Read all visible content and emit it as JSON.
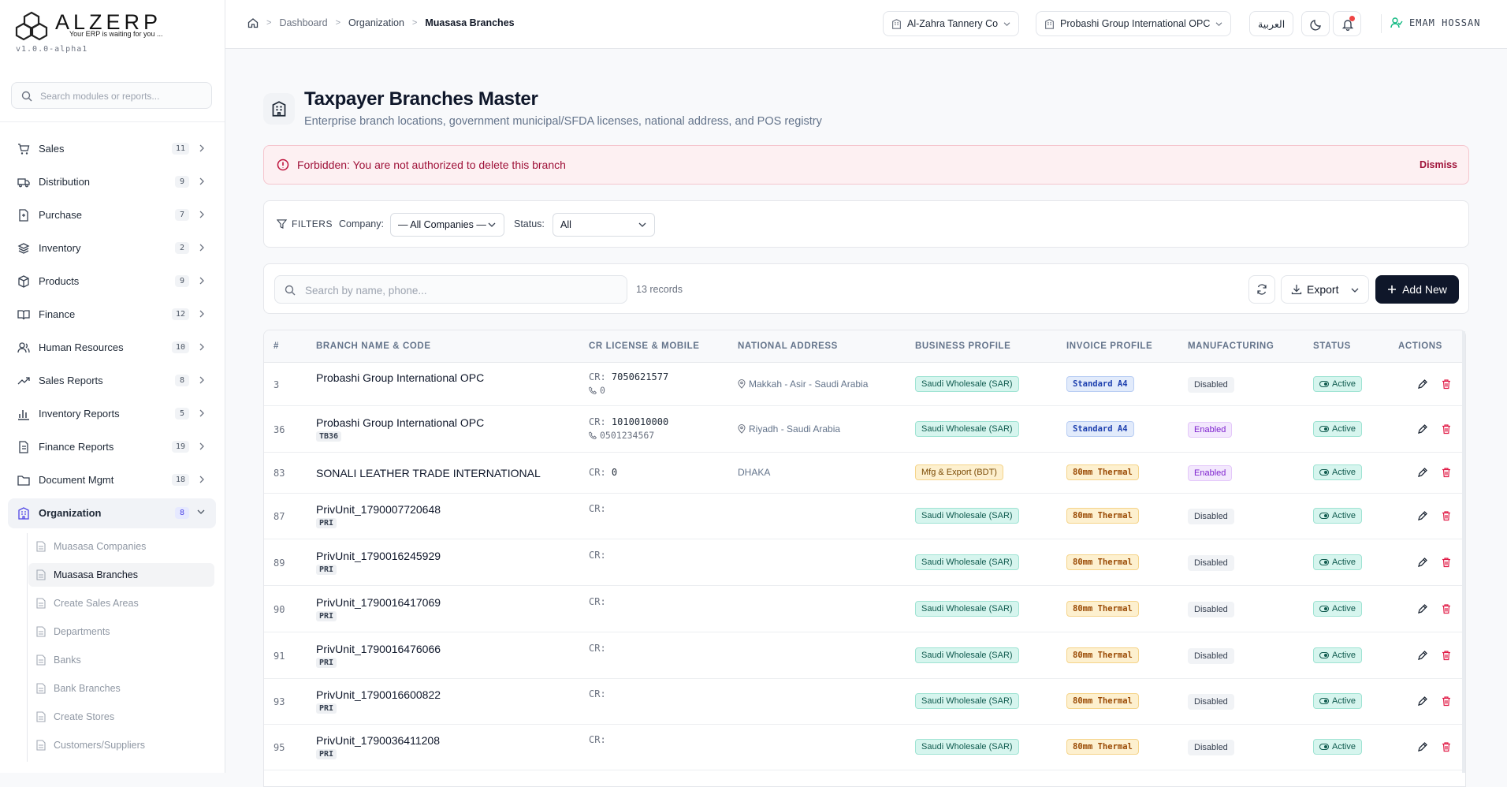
{
  "brand": {
    "name": "ALZERP",
    "tagline": "Your ERP is waiting for you ...",
    "version": "v1.0.0-alpha1"
  },
  "sidebar": {
    "search_placeholder": "Search modules or reports...",
    "items": [
      {
        "label": "Sales",
        "count": "11",
        "icon": "cart-icon"
      },
      {
        "label": "Distribution",
        "count": "9",
        "icon": "truck-icon"
      },
      {
        "label": "Purchase",
        "count": "7",
        "icon": "receipt-icon"
      },
      {
        "label": "Inventory",
        "count": "2",
        "icon": "layers-icon"
      },
      {
        "label": "Products",
        "count": "9",
        "icon": "box-icon"
      },
      {
        "label": "Finance",
        "count": "12",
        "icon": "book-icon"
      },
      {
        "label": "Human Resources",
        "count": "10",
        "icon": "users-icon"
      },
      {
        "label": "Sales Reports",
        "count": "8",
        "icon": "trend-icon"
      },
      {
        "label": "Inventory Reports",
        "count": "5",
        "icon": "bar-chart-icon"
      },
      {
        "label": "Finance Reports",
        "count": "19",
        "icon": "file-icon"
      },
      {
        "label": "Document Mgmt",
        "count": "18",
        "icon": "folder-icon"
      },
      {
        "label": "Organization",
        "count": "8",
        "icon": "building-icon"
      }
    ],
    "subitems": [
      "Muasasa Companies",
      "Muasasa Branches",
      "Create Sales Areas",
      "Departments",
      "Banks",
      "Bank Branches",
      "Create Stores",
      "Customers/Suppliers"
    ]
  },
  "header": {
    "breadcrumb": {
      "root": "Dashboard",
      "mid": "Organization",
      "current": "Muasasa Branches"
    },
    "company_selector": "Al-Zahra Tannery Co",
    "branch_selector": "Probashi Group International OPC",
    "language": "العربية",
    "user": "EMAM HOSSAN"
  },
  "page": {
    "title": "Taxpayer Branches Master",
    "subtitle": "Enterprise branch locations, government municipal/SFDA licenses, national address, and POS registry"
  },
  "alert": {
    "message": "Forbidden: You are not authorized to delete this branch",
    "dismiss": "Dismiss"
  },
  "filters": {
    "title": "FILTERS",
    "company_label": "Company:",
    "company_value": "— All Companies —",
    "status_label": "Status:",
    "status_value": "All"
  },
  "toolbar": {
    "search_placeholder": "Search by name, phone...",
    "records": "13 records",
    "export": "Export",
    "add": "Add New"
  },
  "table": {
    "headers": [
      "#",
      "BRANCH NAME & CODE",
      "CR LICENSE & MOBILE",
      "NATIONAL ADDRESS",
      "BUSINESS PROFILE",
      "INVOICE PROFILE",
      "MANUFACTURING",
      "STATUS",
      "ACTIONS"
    ],
    "cr_prefix": "CR:",
    "rows": [
      {
        "id": "3",
        "name": "Probashi Group International OPC",
        "code": "",
        "cr": "7050621577",
        "mobile": "0",
        "address": "Makkah - Asir - Saudi Arabia",
        "business": "Saudi Wholesale (SAR)",
        "invoice": "Standard A4",
        "manufacturing": "Disabled",
        "status": "Active"
      },
      {
        "id": "36",
        "name": "Probashi Group International OPC",
        "code": "TB36",
        "cr": "1010010000",
        "mobile": "0501234567",
        "address": "Riyadh - Saudi Arabia",
        "business": "Saudi Wholesale (SAR)",
        "invoice": "Standard A4",
        "manufacturing": "Enabled",
        "status": "Active"
      },
      {
        "id": "83",
        "name": "SONALI LEATHER TRADE INTERNATIONAL",
        "code": "",
        "cr": "0",
        "mobile": "",
        "address": "DHAKA",
        "business": "Mfg & Export (BDT)",
        "invoice": "80mm Thermal",
        "manufacturing": "Enabled",
        "status": "Active"
      },
      {
        "id": "87",
        "name": "PrivUnit_1790007720648",
        "code": "PRI",
        "cr": "",
        "mobile": "",
        "address": "",
        "business": "Saudi Wholesale (SAR)",
        "invoice": "80mm Thermal",
        "manufacturing": "Disabled",
        "status": "Active"
      },
      {
        "id": "89",
        "name": "PrivUnit_1790016245929",
        "code": "PRI",
        "cr": "",
        "mobile": "",
        "address": "",
        "business": "Saudi Wholesale (SAR)",
        "invoice": "80mm Thermal",
        "manufacturing": "Disabled",
        "status": "Active"
      },
      {
        "id": "90",
        "name": "PrivUnit_1790016417069",
        "code": "PRI",
        "cr": "",
        "mobile": "",
        "address": "",
        "business": "Saudi Wholesale (SAR)",
        "invoice": "80mm Thermal",
        "manufacturing": "Disabled",
        "status": "Active"
      },
      {
        "id": "91",
        "name": "PrivUnit_1790016476066",
        "code": "PRI",
        "cr": "",
        "mobile": "",
        "address": "",
        "business": "Saudi Wholesale (SAR)",
        "invoice": "80mm Thermal",
        "manufacturing": "Disabled",
        "status": "Active"
      },
      {
        "id": "93",
        "name": "PrivUnit_1790016600822",
        "code": "PRI",
        "cr": "",
        "mobile": "",
        "address": "",
        "business": "Saudi Wholesale (SAR)",
        "invoice": "80mm Thermal",
        "manufacturing": "Disabled",
        "status": "Active"
      },
      {
        "id": "95",
        "name": "PrivUnit_1790036411208",
        "code": "PRI",
        "cr": "",
        "mobile": "",
        "address": "",
        "business": "Saudi Wholesale (SAR)",
        "invoice": "80mm Thermal",
        "manufacturing": "Disabled",
        "status": "Active"
      }
    ]
  }
}
